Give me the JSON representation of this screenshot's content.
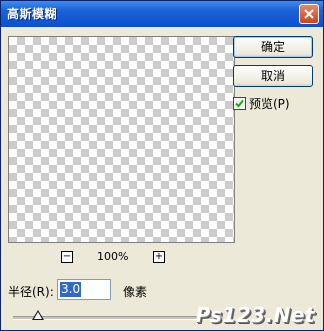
{
  "window": {
    "title": "高斯模糊"
  },
  "buttons": {
    "ok_label": "确定",
    "cancel_label": "取消"
  },
  "preview_option": {
    "label": "预览(P)",
    "checked": true
  },
  "zoom": {
    "minus": "−",
    "plus": "+",
    "level": "100%"
  },
  "radius": {
    "label": "半径(R):",
    "value": "3.0",
    "unit": "像素",
    "slider_fraction": 0.12
  },
  "watermark": {
    "text": "Ps123.Net"
  },
  "colors": {
    "titlebar": "#0a4fd0",
    "dialog_bg": "#ece9d8",
    "selection": "#316ac5"
  }
}
